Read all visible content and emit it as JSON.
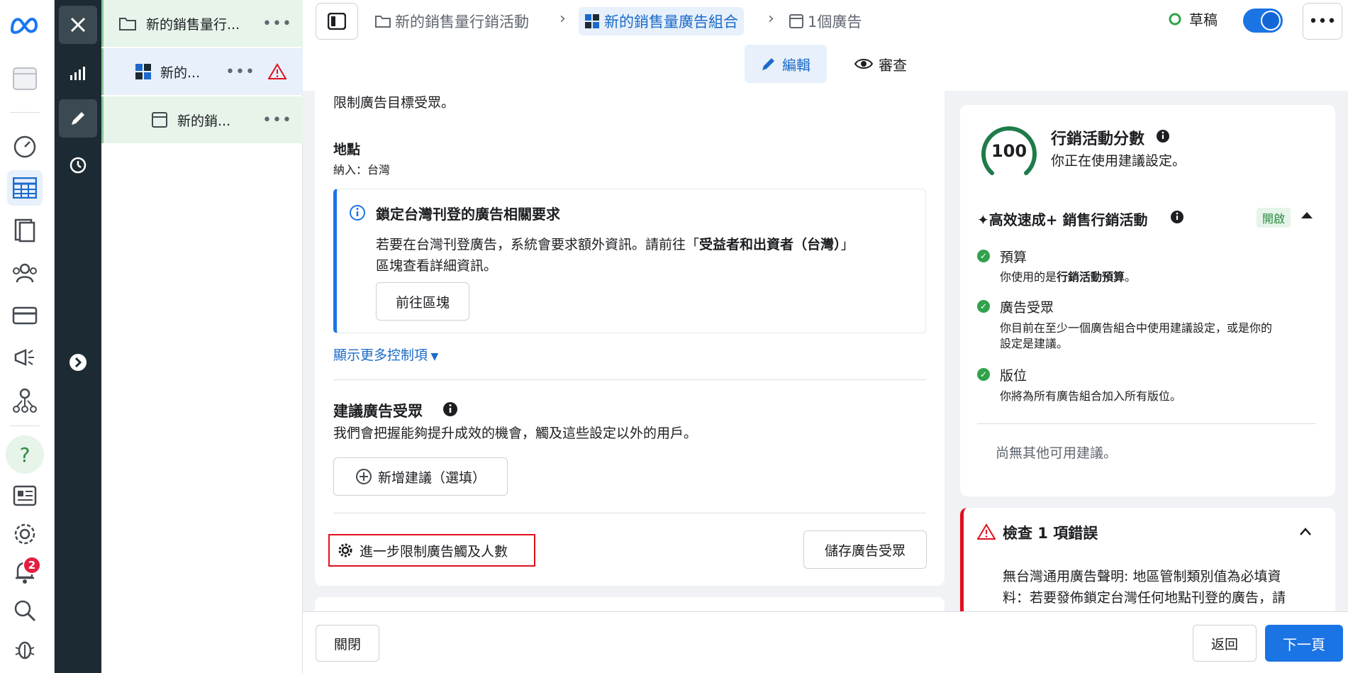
{
  "tree": {
    "campaign": "新的銷售量行...",
    "adset": "新的...",
    "ad": "新的銷..."
  },
  "header": {
    "crumbs": [
      "新的銷售量行銷活動",
      "新的銷售量廣告組合",
      "1個廣告"
    ],
    "status": "草稿",
    "more": "•••",
    "mode_edit": "編輯",
    "mode_review": "審查"
  },
  "main": {
    "limit_text": "限制廣告目標受眾。",
    "location_label": "地點",
    "location_value": "納入：台灣",
    "info_title": "鎖定台灣刊登的廣告相關要求",
    "info_body_1": "若要在台灣刊登廣告，系統會要求額外資訊。請前往「",
    "info_body_bold": "受益者和出資者（台灣）",
    "info_body_2": "」",
    "info_body_3": "區塊查看詳細資訊。",
    "goto_section": "前往區塊",
    "more_controls": "顯示更多控制項",
    "suggest_title": "建議廣告受眾",
    "suggest_desc": "我們會把握能夠提升成效的機會，觸及這些設定以外的用戶。",
    "add_suggestion": "新增建議（選填）",
    "limit_reach": "進一步限制廣告觸及人數",
    "save_audience": "儲存廣告受眾"
  },
  "score": {
    "value": "100",
    "title": "行銷活動分數",
    "subtitle": "你正在使用建議設定。",
    "adv_title": "✦高效速成+ 銷售行銷活動",
    "adv_state": "開啟",
    "items": [
      {
        "title": "預算",
        "desc_a": "你使用的是",
        "desc_bold": "行銷活動預算",
        "desc_b": "。"
      },
      {
        "title": "廣告受眾",
        "desc_line1": "你目前在至少一個廣告組合中使用建議設定，或是你的",
        "desc_line2": "設定是建議。"
      },
      {
        "title": "版位",
        "desc": "你將為所有廣告組合加入所有版位。"
      }
    ],
    "no_more": "尚無其他可用建議。"
  },
  "errors": {
    "title": "檢查 1 項錯誤",
    "line1": "無台灣通用廣告聲明: 地區管制類別值為必填資",
    "line2": "料：若要發佈鎖定台灣任何地點刊登的廣告，請"
  },
  "footer": {
    "close": "關閉",
    "back": "返回",
    "next": "下一頁"
  },
  "notifications": {
    "count": "2"
  },
  "colors": {
    "accent": "#1b74e4",
    "success": "#31a24c",
    "error": "#e0101e"
  }
}
